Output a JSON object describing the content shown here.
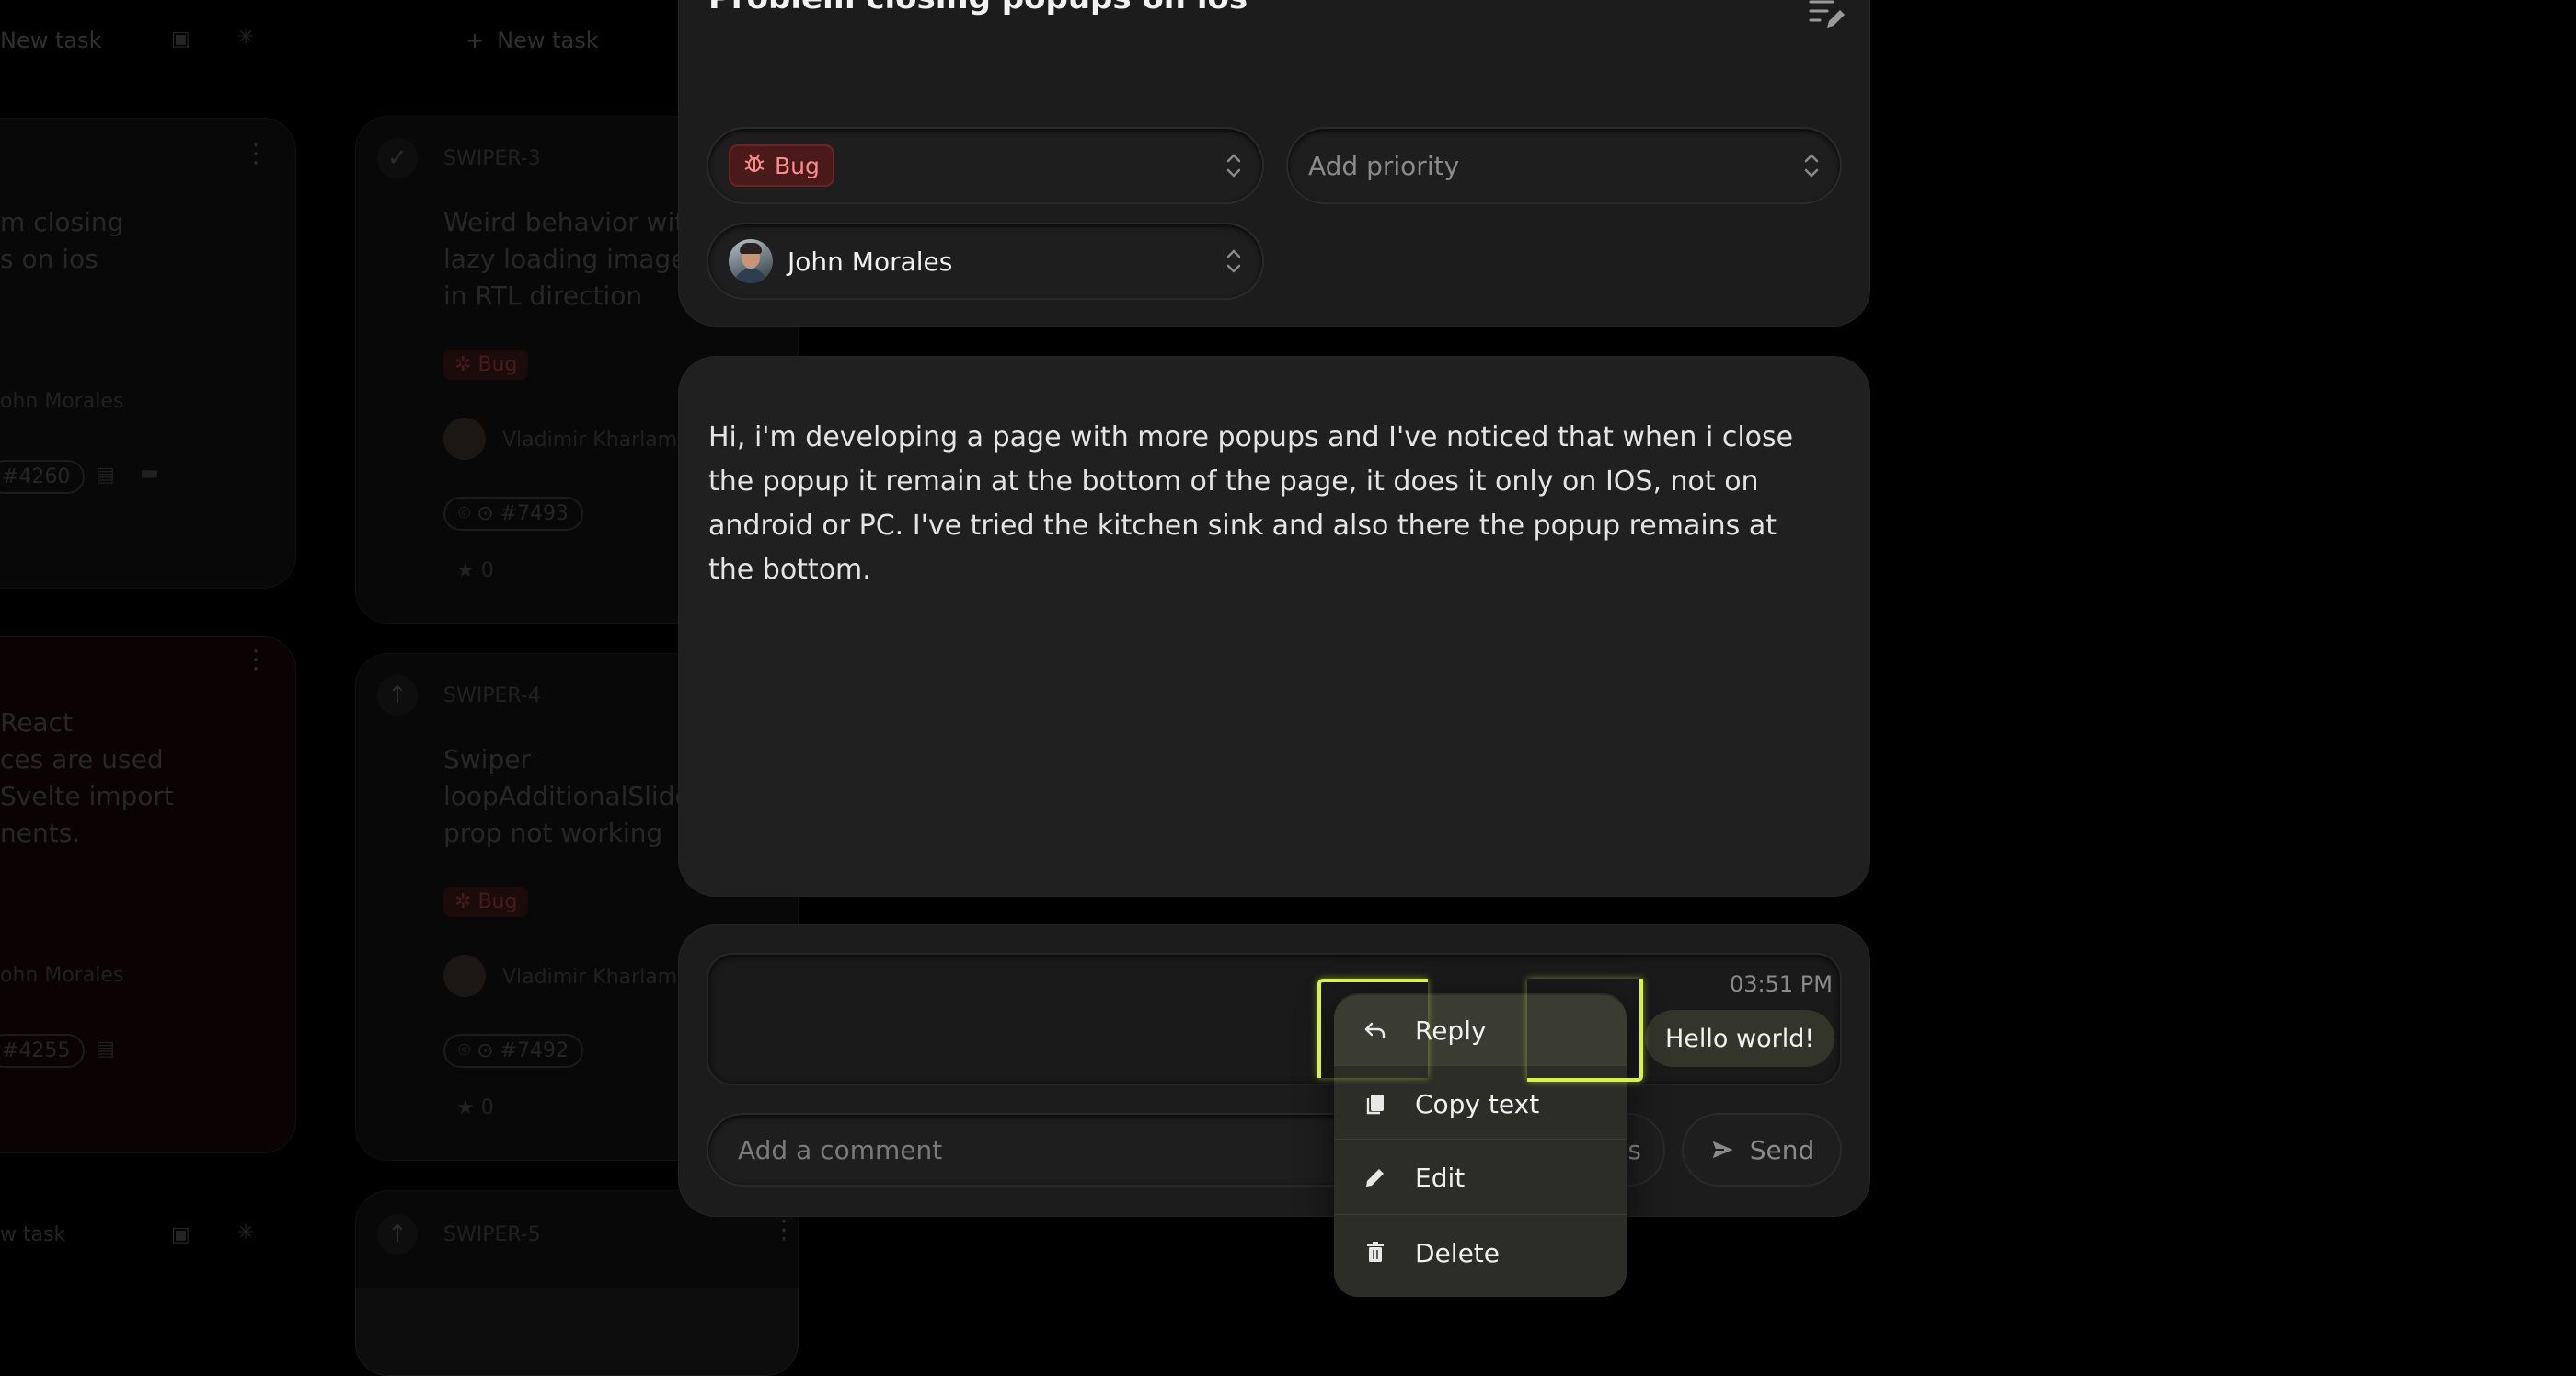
{
  "background": {
    "columns": [
      {
        "new_task": "New task"
      },
      {
        "new_task": "New task"
      }
    ],
    "cards_left": [
      {
        "title_partial": "m closing\ns on ios",
        "assignee": "ohn Morales",
        "pr": "#4260"
      },
      {
        "title_partial": "React\nces are used\nSvelte import\nnents.",
        "assignee": "ohn Morales",
        "pr": "#4255"
      }
    ],
    "cards_mid": [
      {
        "id": "SWIPER-3",
        "title": "Weird behavior with\nlazy loading images\nin RTL direction",
        "badge": "Bug",
        "assignee": "Vladimir Kharlam",
        "pr": "#7493",
        "stars": "0"
      },
      {
        "id": "SWIPER-4",
        "title": "Swiper\nloopAdditionalSlide\nprop not working",
        "badge": "Bug",
        "assignee": "Vladimir Kharlam",
        "pr": "#7492",
        "stars": "0"
      },
      {
        "id": "SWIPER-5"
      }
    ],
    "bottom_new_task": "w task"
  },
  "task": {
    "title": "Problem closing popups on ios",
    "type_label": "Bug",
    "priority_placeholder": "Add priority",
    "assignee": "John Morales",
    "description": "Hi, i'm developing a page with more popups and I've noticed that when i close the popup it remain at the bottom of the page, it does it only on IOS, not on android or PC. I've tried the kitchen sink and also there the popup remains at the bottom."
  },
  "comments": {
    "time": "03:51 PM",
    "message": "Hello world!",
    "input_placeholder": "Add a comment",
    "hidden_button_suffix": "s",
    "send_label": "Send"
  },
  "context_menu": {
    "items": [
      {
        "label": "Reply",
        "icon": "reply-icon"
      },
      {
        "label": "Copy text",
        "icon": "copy-icon"
      },
      {
        "label": "Edit",
        "icon": "pencil-icon"
      },
      {
        "label": "Delete",
        "icon": "trash-icon"
      }
    ]
  },
  "colors": {
    "accent_focus": "#d6f34a",
    "bug_text": "#ff8a8a",
    "bug_bg": "#4a1a1a"
  }
}
